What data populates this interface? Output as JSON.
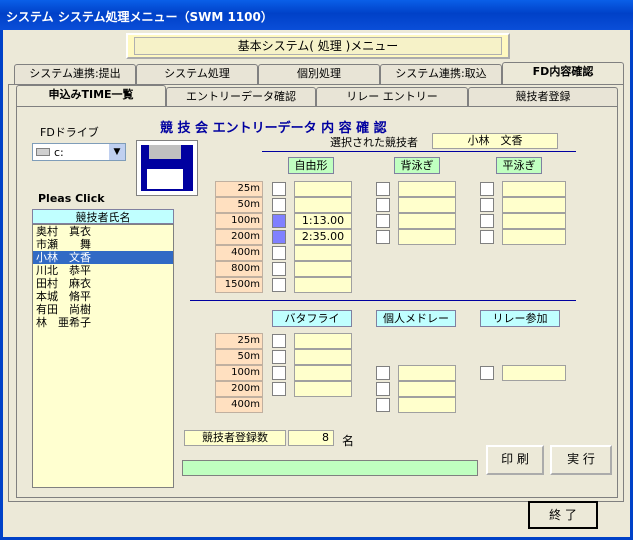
{
  "window": {
    "title": "システム システム処理メニュー（SWM 1100）"
  },
  "menu_title": "基本システム( 処理 )メニュー",
  "top_tabs": [
    {
      "label": "システム連携:提出"
    },
    {
      "label": "システム処理"
    },
    {
      "label": "個別処理"
    },
    {
      "label": "システム連携:取込"
    },
    {
      "label": "FD内容確認"
    }
  ],
  "sub_tabs": [
    {
      "label": "申込みTIME一覧"
    },
    {
      "label": "エントリーデータ確認"
    },
    {
      "label": "リレー エントリー"
    },
    {
      "label": "競技者登録"
    }
  ],
  "fd": {
    "label": "FDドライブ",
    "drive": "c:"
  },
  "list": {
    "click_label": "Pleas Click",
    "header": "競技者氏名",
    "items": [
      "奥村　真衣",
      "市瀬　　舞",
      "小林　文香",
      "川北　恭平",
      "田村　麻衣",
      "本城　脩平",
      "有田　尚樹",
      "林　亜希子"
    ],
    "selected": 2
  },
  "content": {
    "title": "競 技 会 エントリーデータ 内 容 確 認",
    "selected_label": "選択された競技者",
    "selected_value": "小林　文香"
  },
  "strokes_top": [
    {
      "label": "自由形"
    },
    {
      "label": "背泳ぎ"
    },
    {
      "label": "平泳ぎ"
    }
  ],
  "strokes_bottom": [
    {
      "label": "バタフライ"
    },
    {
      "label": "個人メドレー"
    },
    {
      "label": "リレー参加"
    }
  ],
  "distances_top": [
    "25m",
    "50m",
    "100m",
    "200m",
    "400m",
    "800m",
    "1500m"
  ],
  "distances_bottom": [
    "25m",
    "50m",
    "100m",
    "200m",
    "400m"
  ],
  "freestyle_times": [
    "",
    "",
    "1:13.00",
    "2:35.00",
    "",
    "",
    ""
  ],
  "freestyle_checked": [
    false,
    false,
    true,
    true,
    false,
    false,
    false
  ],
  "count": {
    "label": "競技者登録数",
    "value": "8",
    "unit": "名"
  },
  "buttons": {
    "print": "印 刷",
    "execute": "実 行",
    "end": "終 了"
  }
}
